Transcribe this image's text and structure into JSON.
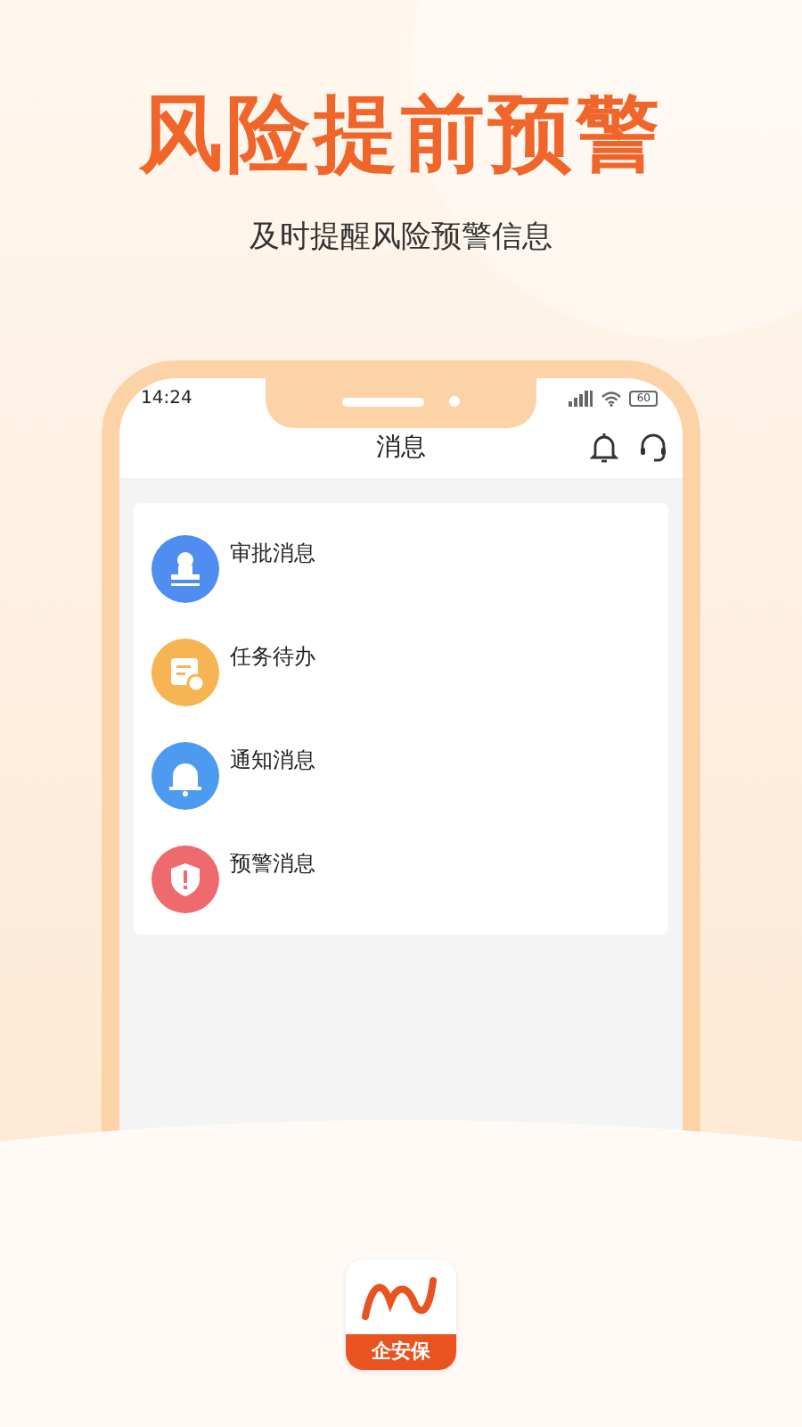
{
  "headline": "风险提前预警",
  "subtitle": "及时提醒风险预警信息",
  "phone": {
    "time": "14:24",
    "battery": "60",
    "title": "消息",
    "items": [
      {
        "label": "审批消息",
        "kind": "stamp",
        "color": "#4f8ef0"
      },
      {
        "label": "任务待办",
        "kind": "task",
        "color": "#f7b452"
      },
      {
        "label": "通知消息",
        "kind": "bell",
        "color": "#4d9bf0"
      },
      {
        "label": "预警消息",
        "kind": "shield",
        "color": "#ef6a6e"
      }
    ]
  },
  "app_logo": {
    "name": "企安保"
  }
}
